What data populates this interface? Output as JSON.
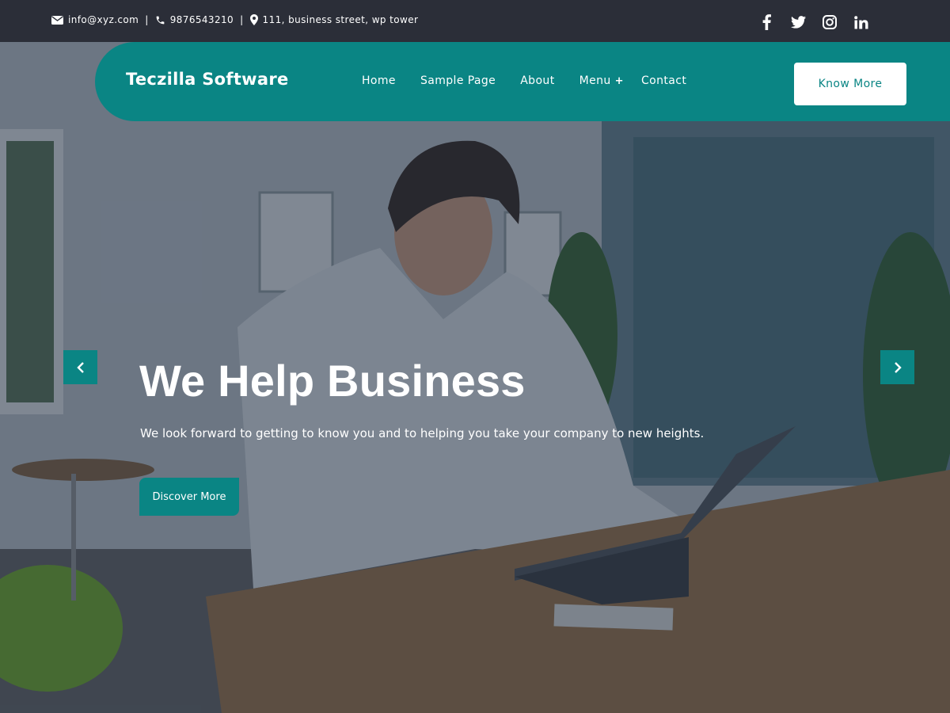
{
  "topbar": {
    "email": "info@xyz.com",
    "phone": "9876543210",
    "address": "111, business street, wp tower",
    "separator": "|",
    "icons": [
      "envelope-icon",
      "phone-icon",
      "map-pin-icon"
    ],
    "social": [
      "facebook-icon",
      "twitter-icon",
      "instagram-icon",
      "linkedin-icon"
    ]
  },
  "nav": {
    "brand": "Teczilla Software",
    "items": [
      {
        "label": "Home"
      },
      {
        "label": "Sample Page"
      },
      {
        "label": "About"
      },
      {
        "label": "Menu",
        "submenu_marker": "+"
      },
      {
        "label": "Contact"
      }
    ],
    "cta": "Know More"
  },
  "hero": {
    "title": "We Help Business",
    "subtitle": "We look forward to getting to know you and to helping you take your company to new heights.",
    "button": "Discover More",
    "prev_icon": "chevron-left-icon",
    "next_icon": "chevron-right-icon",
    "background": "photo of man typing on laptop at wooden table in office"
  },
  "colors": {
    "topbar_bg": "#2b2e38",
    "accent": "#0a8584",
    "text_light": "#ffffff"
  }
}
